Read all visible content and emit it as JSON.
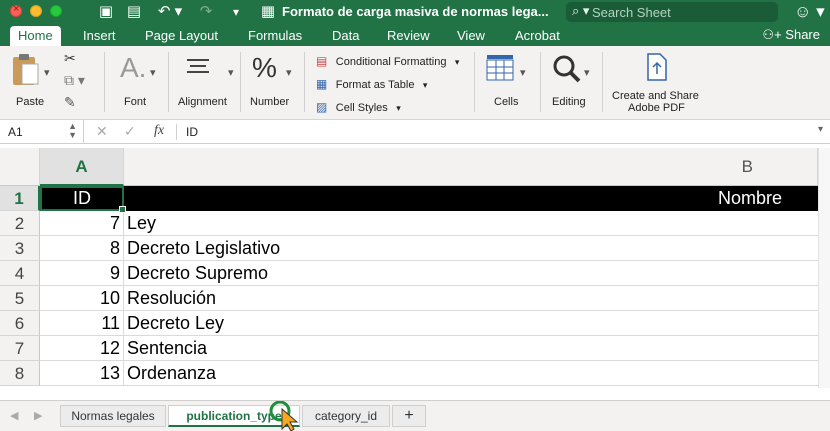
{
  "window": {
    "title": "Formato de carga masiva de normas lega...",
    "search_placeholder": "Search Sheet"
  },
  "ribbon_tabs": [
    "Home",
    "Insert",
    "Page Layout",
    "Formulas",
    "Data",
    "Review",
    "View",
    "Acrobat"
  ],
  "share_label": "Share",
  "ribbon": {
    "paste": "Paste",
    "font": "Font",
    "alignment": "Alignment",
    "number": "Number",
    "conditional_formatting": "Conditional Formatting",
    "format_as_table": "Format as Table",
    "cell_styles": "Cell Styles",
    "cells": "Cells",
    "editing": "Editing",
    "adobe_line1": "Create and Share",
    "adobe_line2": "Adobe PDF"
  },
  "formula_bar": {
    "name_box": "A1",
    "formula": "ID"
  },
  "columns": [
    "A",
    "B"
  ],
  "header_row": {
    "row": "1",
    "a": "ID",
    "b": "Nombre"
  },
  "rows": [
    {
      "row": "2",
      "id": "7",
      "name": "Ley"
    },
    {
      "row": "3",
      "id": "8",
      "name": "Decreto Legislativo"
    },
    {
      "row": "4",
      "id": "9",
      "name": "Decreto Supremo"
    },
    {
      "row": "5",
      "id": "10",
      "name": "Resolución"
    },
    {
      "row": "6",
      "id": "11",
      "name": "Decreto Ley"
    },
    {
      "row": "7",
      "id": "12",
      "name": "Sentencia"
    },
    {
      "row": "8",
      "id": "13",
      "name": "Ordenanza"
    }
  ],
  "sheets": [
    "Normas legales",
    "publication_type",
    "category_id"
  ],
  "active_sheet": 1,
  "colors": {
    "brand": "#217346",
    "header_bg": "#000000"
  }
}
